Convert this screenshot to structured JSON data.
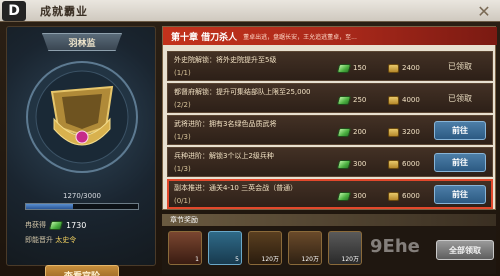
{
  "header": {
    "back_icon": "D",
    "title": "成就霸业",
    "close_icon": "✕"
  },
  "left": {
    "rank_name": "羽林监",
    "progress_text": "1270/3000",
    "progress_fraction": 0.423,
    "owned_label": "冉获得",
    "owned_value": "1730",
    "promote_label": "即能晋升",
    "promote_target": "太史令",
    "view_button": "查看官阶"
  },
  "chapter": {
    "title": "第十章 借刀杀人",
    "desc": "董卓出逃，盘踞长安，王允追逃董卓，至..."
  },
  "tasks": [
    {
      "title": "外史院解锁：将外史院提升至5级",
      "progress": "(1/1)",
      "reward1": "150",
      "reward2": "2400",
      "button": "已领取",
      "state": "done"
    },
    {
      "title": "都督府解锁：提升可集结部队上限至25,000",
      "progress": "(2/2)",
      "reward1": "250",
      "reward2": "4000",
      "button": "已领取",
      "state": "done"
    },
    {
      "title": "武将进阶：拥有3名绿色品质武将",
      "progress": "(1/3)",
      "reward1": "200",
      "reward2": "3200",
      "button": "前往",
      "state": "go"
    },
    {
      "title": "兵种进阶：解锁3个以上2级兵种",
      "progress": "(1/3)",
      "reward1": "300",
      "reward2": "6000",
      "button": "前往",
      "state": "go"
    },
    {
      "title": "副本推进：通关4-10 三英会战（普通）",
      "progress": "(0/1)",
      "reward1": "300",
      "reward2": "6000",
      "button": "前往",
      "state": "go"
    }
  ],
  "chapter_reward": {
    "header": "章节奖励",
    "items": [
      {
        "name": "portrait",
        "count": "1"
      },
      {
        "name": "speed",
        "count": "5"
      },
      {
        "name": "arrow",
        "count": "120万"
      },
      {
        "name": "horn",
        "count": "120万"
      },
      {
        "name": "stone",
        "count": "120万"
      }
    ],
    "claim_all": "全部领取"
  },
  "watermark": "9Ehe"
}
